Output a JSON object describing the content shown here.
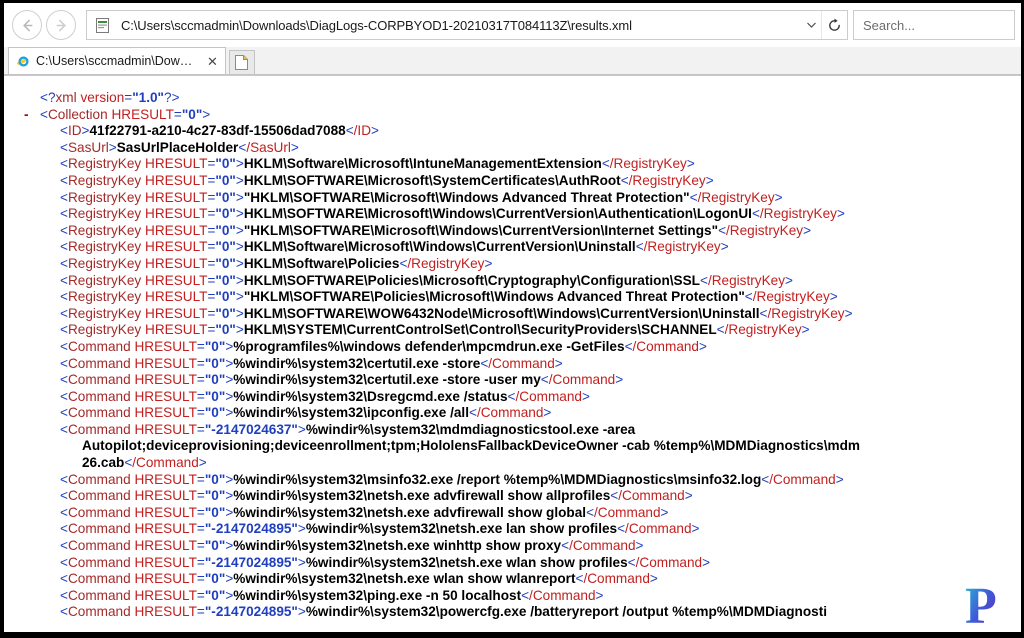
{
  "browser": {
    "back_label": "Back",
    "forward_label": "Forward",
    "address_value": "C:\\Users\\sccmadmin\\Downloads\\DiagLogs-CORPBYOD1-20210317T084113Z\\results.xml",
    "address_icon": "xml-file-icon",
    "dropdown_icon": "chevron-down-icon",
    "refresh_icon": "refresh-icon",
    "search_placeholder": "Search...",
    "tab": {
      "title": "C:\\Users\\sccmadmin\\Downl..",
      "favicon": "internet-explorer-icon",
      "close_label": "✕"
    },
    "new_tab_label": "New tab"
  },
  "xml": {
    "declaration": {
      "open": "<?",
      "name": "xml",
      "attr": "version",
      "value": "\"1.0\"",
      "close": "?>"
    },
    "collapse_marker": "-",
    "root": {
      "open": "<",
      "name": "Collection",
      "attr": "HRESULT",
      "value": "\"0\"",
      "gt": ">"
    },
    "simple_nodes": [
      {
        "name": "ID",
        "text": "41f22791-a210-4c27-83df-15506dad7088"
      },
      {
        "name": "SasUrl",
        "text": "SasUrlPlaceHolder"
      }
    ],
    "registry_keys": [
      {
        "tag": "RegistryKey",
        "attr": "HRESULT",
        "hresult": "\"0\"",
        "text": "HKLM\\Software\\Microsoft\\IntuneManagementExtension"
      },
      {
        "tag": "RegistryKey",
        "attr": "HRESULT",
        "hresult": "\"0\"",
        "text": "HKLM\\SOFTWARE\\Microsoft\\SystemCertificates\\AuthRoot"
      },
      {
        "tag": "RegistryKey",
        "attr": "HRESULT",
        "hresult": "\"0\"",
        "text": "\"HKLM\\SOFTWARE\\Microsoft\\Windows Advanced Threat Protection\""
      },
      {
        "tag": "RegistryKey",
        "attr": "HRESULT",
        "hresult": "\"0\"",
        "text": "HKLM\\SOFTWARE\\Microsoft\\Windows\\CurrentVersion\\Authentication\\LogonUI"
      },
      {
        "tag": "RegistryKey",
        "attr": "HRESULT",
        "hresult": "\"0\"",
        "text": "\"HKLM\\SOFTWARE\\Microsoft\\Windows\\CurrentVersion\\Internet Settings\""
      },
      {
        "tag": "RegistryKey",
        "attr": "HRESULT",
        "hresult": "\"0\"",
        "text": "HKLM\\Software\\Microsoft\\Windows\\CurrentVersion\\Uninstall"
      },
      {
        "tag": "RegistryKey",
        "attr": "HRESULT",
        "hresult": "\"0\"",
        "text": "HKLM\\Software\\Policies"
      },
      {
        "tag": "RegistryKey",
        "attr": "HRESULT",
        "hresult": "\"0\"",
        "text": "HKLM\\SOFTWARE\\Policies\\Microsoft\\Cryptography\\Configuration\\SSL"
      },
      {
        "tag": "RegistryKey",
        "attr": "HRESULT",
        "hresult": "\"0\"",
        "text": "\"HKLM\\SOFTWARE\\Policies\\Microsoft\\Windows Advanced Threat Protection\""
      },
      {
        "tag": "RegistryKey",
        "attr": "HRESULT",
        "hresult": "\"0\"",
        "text": "HKLM\\SOFTWARE\\WOW6432Node\\Microsoft\\Windows\\CurrentVersion\\Uninstall"
      },
      {
        "tag": "RegistryKey",
        "attr": "HRESULT",
        "hresult": "\"0\"",
        "text": "HKLM\\SYSTEM\\CurrentControlSet\\Control\\SecurityProviders\\SCHANNEL"
      }
    ],
    "commands": [
      {
        "tag": "Command",
        "attr": "HRESULT",
        "hresult": "\"0\"",
        "text": "%programfiles%\\windows defender\\mpcmdrun.exe -GetFiles"
      },
      {
        "tag": "Command",
        "attr": "HRESULT",
        "hresult": "\"0\"",
        "text": "%windir%\\system32\\certutil.exe -store"
      },
      {
        "tag": "Command",
        "attr": "HRESULT",
        "hresult": "\"0\"",
        "text": "%windir%\\system32\\certutil.exe -store -user my"
      },
      {
        "tag": "Command",
        "attr": "HRESULT",
        "hresult": "\"0\"",
        "text": "%windir%\\system32\\Dsregcmd.exe /status"
      },
      {
        "tag": "Command",
        "attr": "HRESULT",
        "hresult": "\"0\"",
        "text": "%windir%\\system32\\ipconfig.exe /all"
      }
    ],
    "wrapped_command": {
      "tag": "Command",
      "attr": "HRESULT",
      "hresult": "\"-2147024637\"",
      "line1": "%windir%\\system32\\mdmdiagnosticstool.exe -area",
      "line2": "Autopilot;deviceprovisioning;deviceenrollment;tpm;HololensFallbackDeviceOwner -cab %temp%\\MDMDiagnostics\\mdm",
      "line3": "26.cab"
    },
    "commands_2": [
      {
        "tag": "Command",
        "attr": "HRESULT",
        "hresult": "\"0\"",
        "text": "%windir%\\system32\\msinfo32.exe /report %temp%\\MDMDiagnostics\\msinfo32.log"
      },
      {
        "tag": "Command",
        "attr": "HRESULT",
        "hresult": "\"0\"",
        "text": "%windir%\\system32\\netsh.exe advfirewall show allprofiles"
      },
      {
        "tag": "Command",
        "attr": "HRESULT",
        "hresult": "\"0\"",
        "text": "%windir%\\system32\\netsh.exe advfirewall show global"
      },
      {
        "tag": "Command",
        "attr": "HRESULT",
        "hresult": "\"-2147024895\"",
        "text": "%windir%\\system32\\netsh.exe lan show profiles"
      },
      {
        "tag": "Command",
        "attr": "HRESULT",
        "hresult": "\"0\"",
        "text": "%windir%\\system32\\netsh.exe winhttp show proxy"
      },
      {
        "tag": "Command",
        "attr": "HRESULT",
        "hresult": "\"-2147024895\"",
        "text": "%windir%\\system32\\netsh.exe wlan show profiles"
      },
      {
        "tag": "Command",
        "attr": "HRESULT",
        "hresult": "\"0\"",
        "text": "%windir%\\system32\\netsh.exe wlan show wlanreport"
      },
      {
        "tag": "Command",
        "attr": "HRESULT",
        "hresult": "\"0\"",
        "text": "%windir%\\system32\\ping.exe -n 50 localhost"
      }
    ],
    "clipped_last_line": {
      "tag": "Command",
      "attr": "HRESULT",
      "hresult": "\"-2147024895\"",
      "text": "%windir%\\system32\\powercfg.exe /batteryreport /output %temp%\\MDMDiagnosti"
    }
  },
  "watermark": {
    "letter": "P",
    "color_start": "#2bbfd0",
    "color_end": "#6a1fb0"
  },
  "colors": {
    "tag": "#a52a2a",
    "attribute": "#c22020",
    "value": "#1f3fbf",
    "text": "#000000",
    "punctuation": "#1f3fbf"
  }
}
